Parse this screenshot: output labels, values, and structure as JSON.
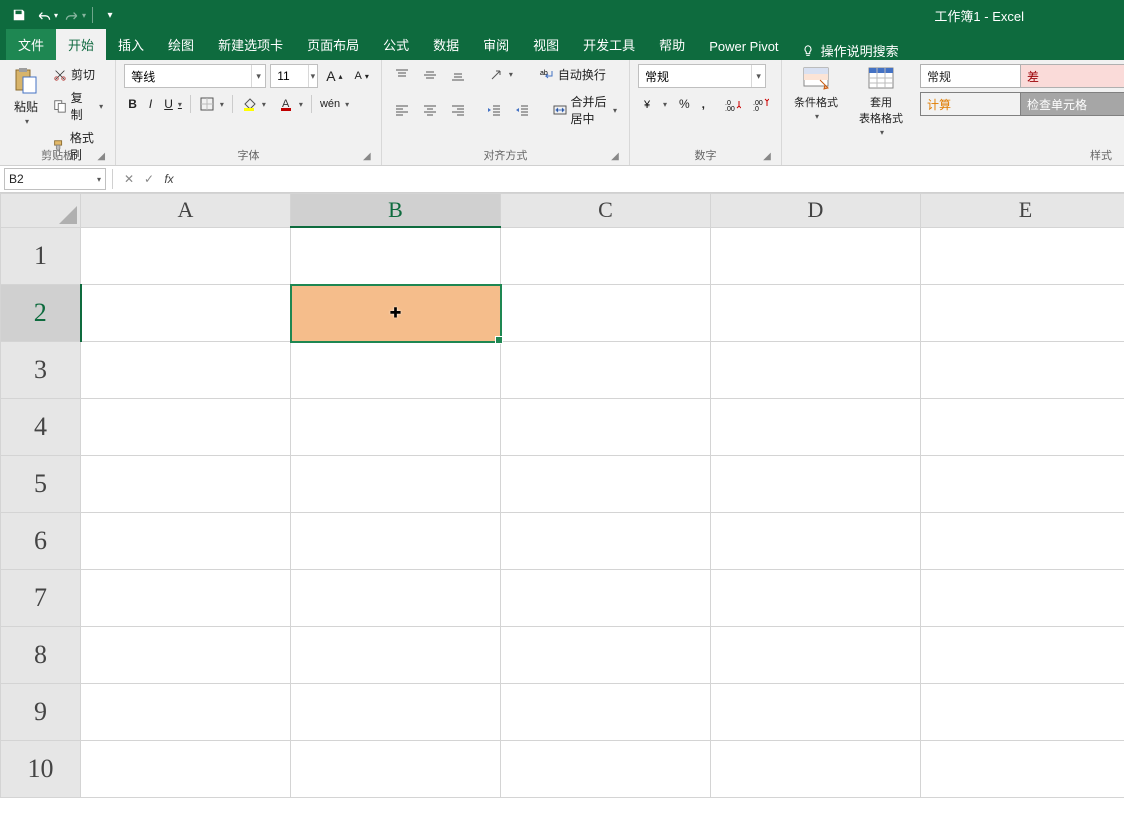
{
  "app": {
    "title": "工作簿1  -  Excel"
  },
  "qat": {
    "save": "save-icon",
    "undo": "undo-icon",
    "redo": "redo-icon",
    "customize": "customize-icon"
  },
  "tabs": {
    "file": "文件",
    "items": [
      "开始",
      "插入",
      "绘图",
      "新建选项卡",
      "页面布局",
      "公式",
      "数据",
      "审阅",
      "视图",
      "开发工具",
      "帮助",
      "Power Pivot"
    ],
    "active": "开始",
    "tellme": "操作说明搜索"
  },
  "ribbon": {
    "clipboard": {
      "paste": "粘贴",
      "cut": "剪切",
      "copy": "复制",
      "fmtpainter": "格式刷",
      "label": "剪贴板"
    },
    "font": {
      "name": "等线",
      "size": "11",
      "grow": "A",
      "shrink": "A",
      "bold": "B",
      "italic": "I",
      "underline": "U",
      "ruby": "wén",
      "label": "字体"
    },
    "align": {
      "wrap": "自动换行",
      "merge": "合并后居中",
      "label": "对齐方式"
    },
    "number": {
      "format": "常规",
      "percent": "%",
      "comma": ",",
      "label": "数字"
    },
    "styles": {
      "cond": "条件格式",
      "table": "套用\n表格格式",
      "cells": [
        {
          "text": "常规",
          "bg": "#ffffff",
          "border": "#b0b0b0",
          "color": "#222"
        },
        {
          "text": "差",
          "bg": "#fadbd9",
          "border": "#b0b0b0",
          "color": "#9c0006"
        },
        {
          "text": "计算",
          "bg": "#f2f2f2",
          "border": "#808080",
          "color": "#e07c00"
        },
        {
          "text": "检查单元格",
          "bg": "#a6a6a6",
          "border": "#808080",
          "color": "#ffffff"
        }
      ],
      "label": "样式"
    }
  },
  "formula_bar": {
    "name": "B2",
    "value": ""
  },
  "grid": {
    "columns": [
      "A",
      "B",
      "C",
      "D",
      "E"
    ],
    "rows": [
      "1",
      "2",
      "3",
      "4",
      "5",
      "6",
      "7",
      "8",
      "9",
      "10"
    ],
    "selected": {
      "col": "B",
      "row": "2"
    }
  }
}
